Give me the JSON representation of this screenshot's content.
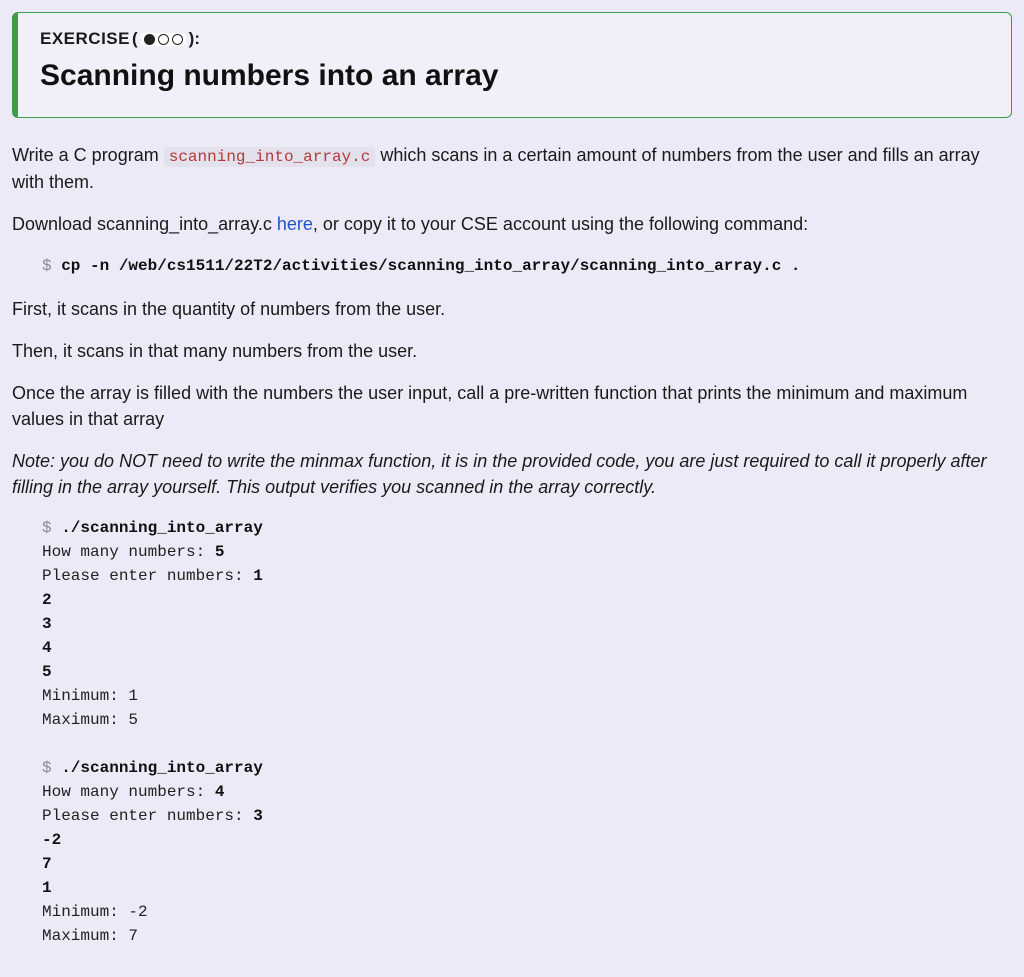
{
  "exercise_box": {
    "label_prefix": "EXERCISE",
    "label_open": "(",
    "label_close": "):",
    "difficulty_filled": 1,
    "difficulty_total": 3,
    "title": "Scanning numbers into an array"
  },
  "body": {
    "p1_a": "Write a C program ",
    "p1_code": "scanning_into_array.c",
    "p1_b": " which scans in a certain amount of numbers from the user and fills an array with them.",
    "p2_a": "Download scanning_into_array.c ",
    "p2_link": "here",
    "p2_b": ", or copy it to your CSE account using the following command:",
    "cp_prompt": "$ ",
    "cp_cmd": "cp -n /web/cs1511/22T2/activities/scanning_into_array/scanning_into_array.c .",
    "p3": "First, it scans in the quantity of numbers from the user.",
    "p4": "Then, it scans in that many numbers from the user.",
    "p5": "Once the array is filled with the numbers the user input, call a pre-written function that prints the minimum and maximum values in that array",
    "note": "Note: you do NOT need to write the minmax function, it is in the provided code, you are just required to call it properly after filling in the array yourself. This output verifies you scanned in the array correctly.",
    "sample1": {
      "prompt": "$ ",
      "cmd": "./scanning_into_array",
      "l1a": "How many numbers: ",
      "l1b": "5",
      "l2a": "Please enter numbers: ",
      "l2b": "1",
      "l3": "2",
      "l4": "3",
      "l5": "4",
      "l6": "5",
      "l7": "Minimum: 1",
      "l8": "Maximum: 5"
    },
    "sample2": {
      "prompt": "$ ",
      "cmd": "./scanning_into_array",
      "l1a": "How many numbers: ",
      "l1b": "4",
      "l2a": "Please enter numbers: ",
      "l2b": "3",
      "l3": "-2",
      "l4": "7",
      "l5": "1",
      "l6": "Minimum: -2",
      "l7": "Maximum: 7"
    }
  }
}
